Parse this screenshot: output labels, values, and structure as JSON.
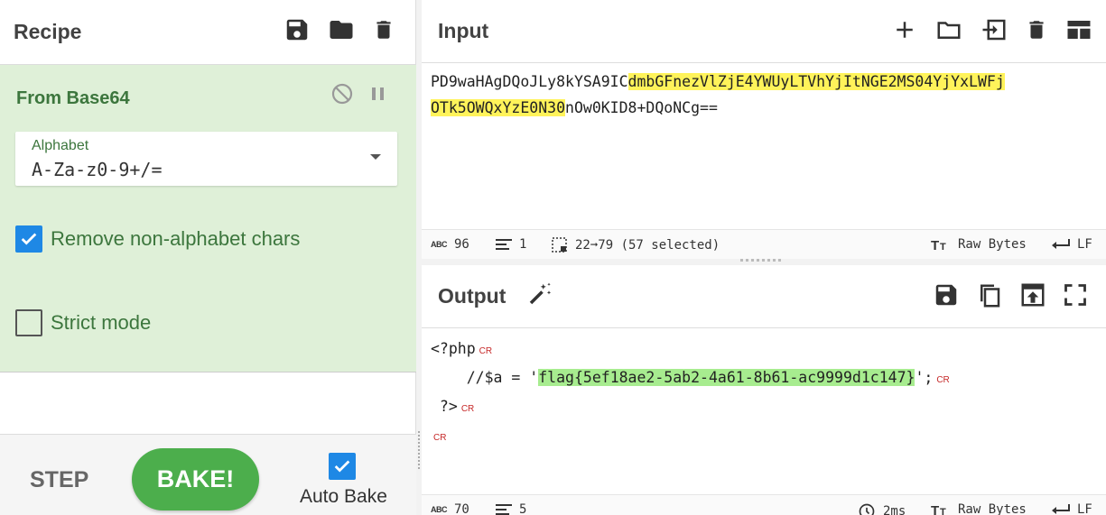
{
  "recipe": {
    "title": "Recipe",
    "operation": {
      "name": "From Base64",
      "alphabet_label": "Alphabet",
      "alphabet_value": "A-Za-z0-9+/=",
      "remove_non_alphabet_label": "Remove non-alphabet chars",
      "remove_non_alphabet_checked": true,
      "strict_mode_label": "Strict mode",
      "strict_mode_checked": false
    },
    "step_label": "STEP",
    "bake_label": "BAKE!",
    "auto_bake_label": "Auto Bake",
    "auto_bake_checked": true
  },
  "input": {
    "title": "Input",
    "line1_pre": "PD9waHAgDQoJLy8kYSA9IC",
    "line1_sel": "dmbGFnezVlZjE4YWUyLTVhYjItNGE2MS04YjYxLWFj",
    "line2_sel": "OTk5OWQxYzE0N30",
    "line2_post": "nOw0KID8+DQoNCg==",
    "stats": {
      "length": "96",
      "lines": "1",
      "selection": "22➞79 (57 selected)",
      "encoding": "Raw Bytes",
      "eol": "LF"
    }
  },
  "output": {
    "title": "Output",
    "line1": "<?php",
    "line2_pre": "    //$a = '",
    "line2_hl": "flag{5ef18ae2-5ab2-4a61-8b61-ac9999d1c147}",
    "line2_post": "';",
    "line3": " ?>",
    "cr_marker": "CR",
    "stats": {
      "length": "70",
      "lines": "5",
      "time": "2ms",
      "encoding": "Raw Bytes",
      "eol": "LF"
    }
  },
  "colors": {
    "accent_green": "#3c763d",
    "operation_bg": "#dff0d8",
    "bake_green": "#4cae4c",
    "checkbox_blue": "#1e88e5",
    "input_highlight": "#fff35a",
    "output_highlight": "#a7ec8f"
  }
}
